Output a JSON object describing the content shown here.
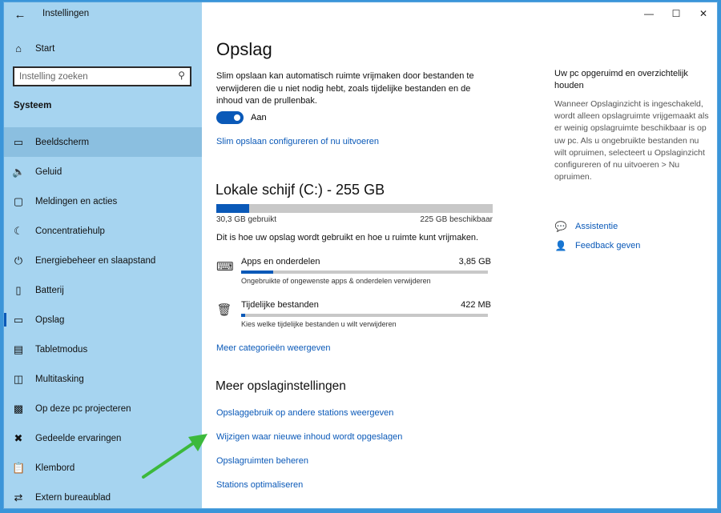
{
  "window": {
    "title": "Instellingen"
  },
  "sidebar": {
    "home_label": "Start",
    "search_placeholder": "Instelling zoeken",
    "section_title": "Systeem",
    "items": [
      {
        "label": "Beeldscherm",
        "icon": "monitor-icon"
      },
      {
        "label": "Geluid",
        "icon": "speaker-icon"
      },
      {
        "label": "Meldingen en acties",
        "icon": "notification-icon"
      },
      {
        "label": "Concentratiehulp",
        "icon": "moon-icon"
      },
      {
        "label": "Energiebeheer en slaapstand",
        "icon": "power-icon"
      },
      {
        "label": "Batterij",
        "icon": "battery-icon"
      },
      {
        "label": "Opslag",
        "icon": "storage-icon"
      },
      {
        "label": "Tabletmodus",
        "icon": "tablet-icon"
      },
      {
        "label": "Multitasking",
        "icon": "multitasking-icon"
      },
      {
        "label": "Op deze pc projecteren",
        "icon": "project-icon"
      },
      {
        "label": "Gedeelde ervaringen",
        "icon": "shared-icon"
      },
      {
        "label": "Klembord",
        "icon": "clipboard-icon"
      },
      {
        "label": "Extern bureaublad",
        "icon": "remote-icon"
      }
    ]
  },
  "main": {
    "title": "Opslag",
    "description": "Slim opslaan kan automatisch ruimte vrijmaken door bestanden te verwijderen die u niet nodig hebt, zoals tijdelijke bestanden en de inhoud van de prullenbak.",
    "toggle_label": "Aan",
    "toggle_on": true,
    "configure_link": "Slim opslaan configureren of nu uitvoeren",
    "drive_title": "Lokale schijf (C:) - 255 GB",
    "drive_used_fraction": 0.12,
    "used_label": "30,3 GB gebruikt",
    "available_label": "225 GB beschikbaar",
    "usage_info": "Dit is hoe uw opslag wordt gebruikt en hoe u ruimte kunt vrijmaken.",
    "categories": [
      {
        "name": "Apps en onderdelen",
        "size": "3,85 GB",
        "sub": "Ongebruikte of ongewenste apps & onderdelen verwijderen",
        "fraction": 0.13
      },
      {
        "name": "Tijdelijke bestanden",
        "size": "422 MB",
        "sub": "Kies welke tijdelijke bestanden u wilt verwijderen",
        "fraction": 0.015
      }
    ],
    "more_categories_link": "Meer categorieën weergeven",
    "more_settings_title": "Meer opslaginstellingen",
    "more_links": [
      "Opslaggebruik op andere stations weergeven",
      "Wijzigen waar nieuwe inhoud wordt opgeslagen",
      "Opslagruimten beheren",
      "Stations optimaliseren"
    ]
  },
  "right_panel": {
    "title": "Uw pc opgeruimd en overzichtelijk houden",
    "description": "Wanneer Opslaginzicht is ingeschakeld, wordt alleen opslagruimte vrijgemaakt als er weinig opslagruimte beschikbaar is op uw pc. Als u ongebruikte bestanden nu wilt opruimen, selecteert u Opslaginzicht configureren of nu uitvoeren > Nu opruimen.",
    "help_link": "Assistentie",
    "feedback_link": "Feedback geven"
  },
  "colors": {
    "accent": "#0a59b8",
    "sidebar_bg": "#a6d4f0",
    "annotation_arrow": "#3cb93c"
  }
}
